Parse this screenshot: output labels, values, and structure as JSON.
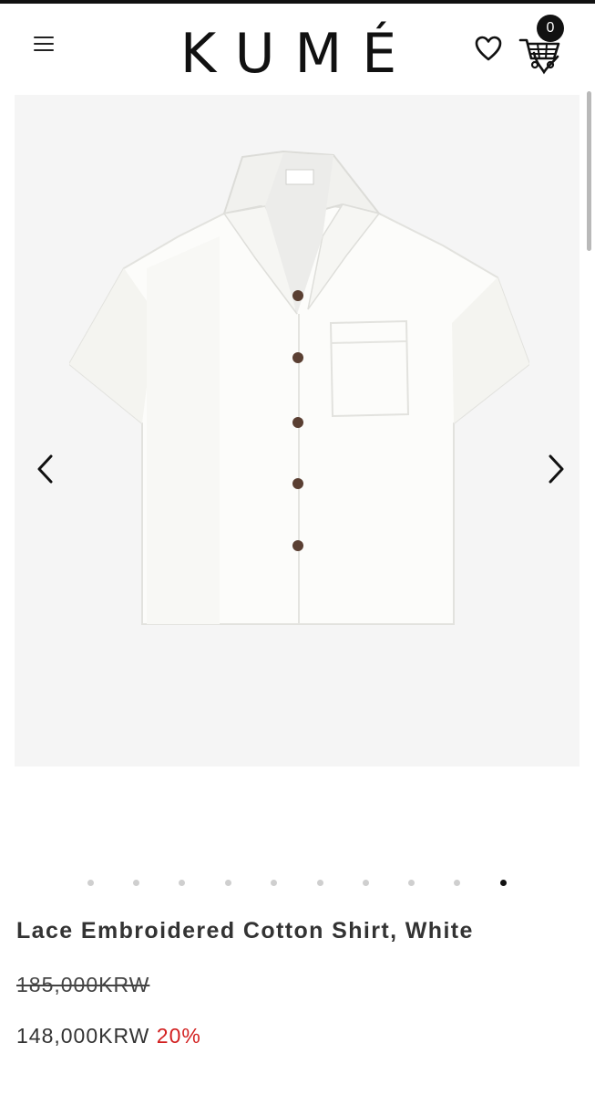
{
  "header": {
    "logo": "KUMÉ",
    "cart_count": "0"
  },
  "gallery": {
    "image_description": "White short-sleeve lace embroidered camp-collar shirt with brown buttons",
    "total_images": 10,
    "active_index": 9
  },
  "product": {
    "title": "Lace Embroidered Cotton Shirt, White",
    "original_price": "185,000KRW",
    "sale_price": "148,000KRW",
    "discount": "20%"
  },
  "colors": {
    "discount": "#d21f1f",
    "badge": "#111111",
    "gallery_bg": "#f5f5f5"
  },
  "icons": [
    "menu-icon",
    "heart-icon",
    "cart-icon",
    "chevron-left-icon",
    "chevron-right-icon"
  ]
}
